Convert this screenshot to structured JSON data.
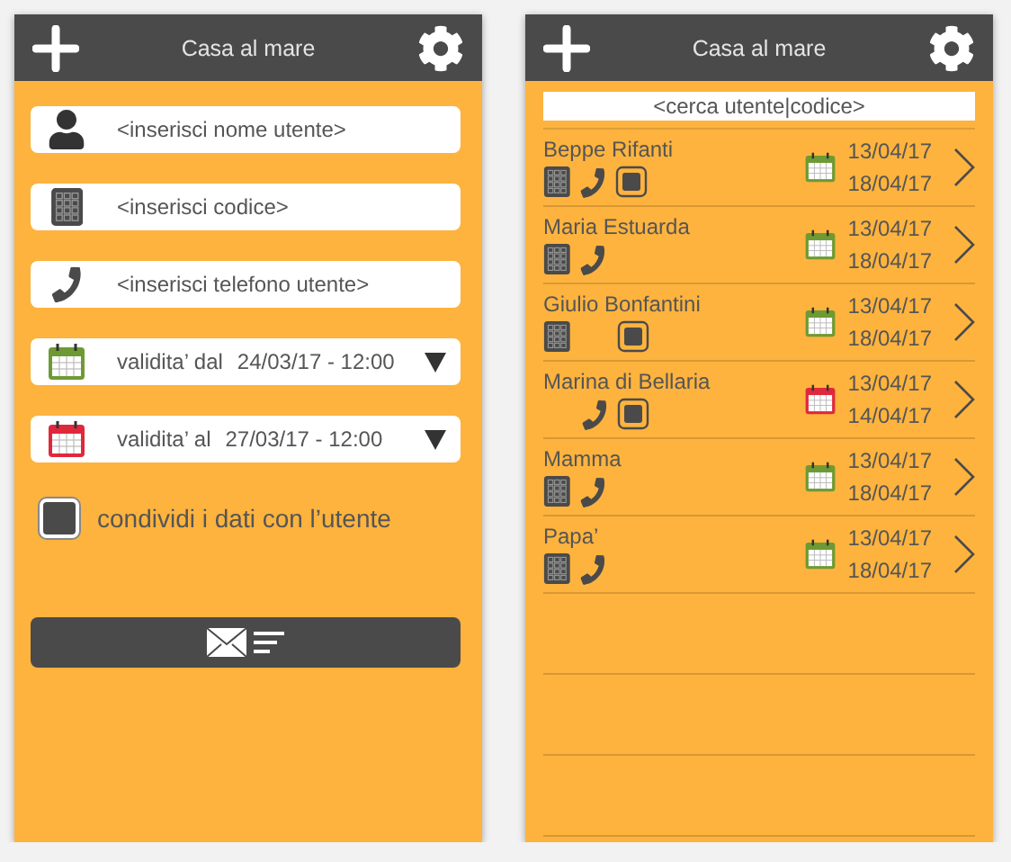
{
  "form_screen": {
    "title": "Casa al mare",
    "fields": [
      {
        "kind": "user",
        "placeholder": "<inserisci nome utente>"
      },
      {
        "kind": "code",
        "placeholder": "<inserisci codice>"
      },
      {
        "kind": "phone",
        "placeholder": "<inserisci telefono utente>"
      }
    ],
    "dates": [
      {
        "label": "validita’ dal",
        "value": "24/03/17 - 12:00",
        "color": "#6e9a34"
      },
      {
        "label": "validita’ al",
        "value": "27/03/17 - 12:00",
        "color": "#e0283c"
      }
    ],
    "share": {
      "label": "condividi i dati con l’utente",
      "checked": true
    }
  },
  "list_screen": {
    "title": "Casa al mare",
    "search": {
      "placeholder": "<cerca utente|codice>"
    },
    "contacts": [
      {
        "name": "Beppe Rifanti",
        "code": true,
        "phone": true,
        "shared": true,
        "color": "#6e9a34",
        "from": "13/04/17",
        "to": "18/04/17"
      },
      {
        "name": "Maria Estuarda",
        "code": true,
        "phone": true,
        "shared": false,
        "color": "#6e9a34",
        "from": "13/04/17",
        "to": "18/04/17"
      },
      {
        "name": "Giulio Bonfantini",
        "code": true,
        "phone": false,
        "shared": true,
        "color": "#6e9a34",
        "from": "13/04/17",
        "to": "18/04/17"
      },
      {
        "name": "Marina di Bellaria",
        "code": false,
        "phone": true,
        "shared": true,
        "color": "#e0283c",
        "from": "13/04/17",
        "to": "14/04/17"
      },
      {
        "name": "Mamma",
        "code": true,
        "phone": true,
        "shared": false,
        "color": "#6e9a34",
        "from": "13/04/17",
        "to": "18/04/17"
      },
      {
        "name": "Papa’",
        "code": true,
        "phone": true,
        "shared": false,
        "color": "#6e9a34",
        "from": "13/04/17",
        "to": "18/04/17"
      }
    ]
  }
}
